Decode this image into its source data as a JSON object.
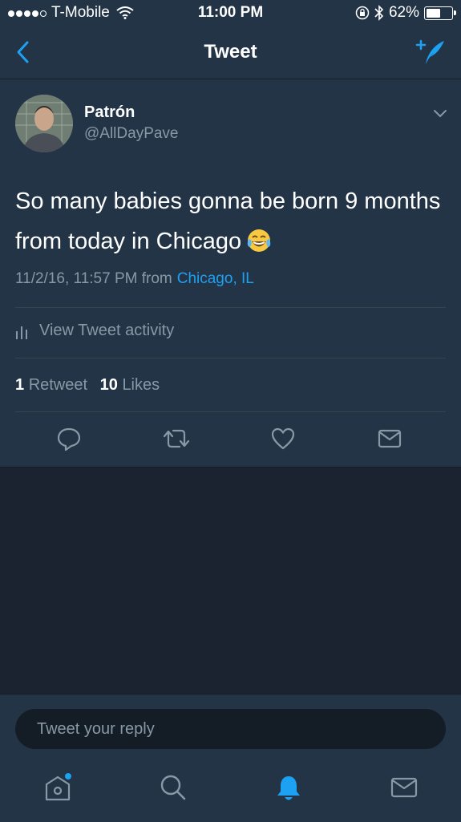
{
  "status": {
    "carrier": "T-Mobile",
    "time": "11:00 PM",
    "battery": "62%",
    "battery_level": 0.62
  },
  "nav": {
    "title": "Tweet"
  },
  "tweet": {
    "name": "Patrón",
    "handle": "@AllDayPave",
    "text": "So many babies gonna be born 9 months from today in Chicago",
    "timestamp": "11/2/16, 11:57 PM from",
    "location": "Chicago, IL",
    "activity_label": "View Tweet activity",
    "retweet_count": "1",
    "retweet_label": "Retweet",
    "like_count": "10",
    "like_label": "Likes"
  },
  "reply": {
    "placeholder": "Tweet your reply"
  },
  "icons": {
    "back": "chevron-left-icon",
    "compose": "compose-tweet-icon",
    "caret": "chevron-down-icon",
    "reply": "reply-icon",
    "retweet": "retweet-icon",
    "like": "heart-icon",
    "dm": "mail-icon",
    "home": "home-icon",
    "search": "search-icon",
    "notifications": "bell-icon",
    "messages": "mail-icon"
  },
  "colors": {
    "accent": "#1da1f2",
    "background": "#243447",
    "secondary_text": "#8899a6"
  }
}
